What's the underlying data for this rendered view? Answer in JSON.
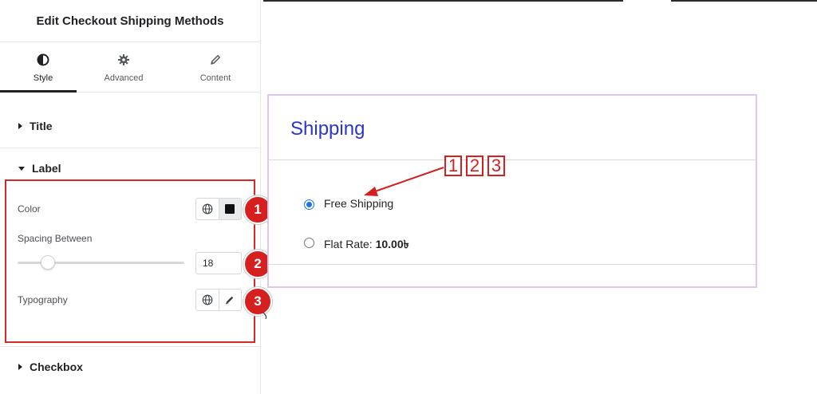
{
  "panel": {
    "title": "Edit Checkout Shipping Methods",
    "tabs": [
      {
        "label": "Style",
        "icon": "contrast-icon",
        "active": true
      },
      {
        "label": "Advanced",
        "icon": "gear-icon",
        "active": false
      },
      {
        "label": "Content",
        "icon": "pencil-icon",
        "active": false
      }
    ],
    "sections": {
      "title": "Title",
      "label": "Label",
      "checkbox": "Checkbox"
    },
    "controls": {
      "color_label": "Color",
      "spacing_label": "Spacing Between",
      "spacing_value": "18",
      "spacing_level": 0.18,
      "typography_label": "Typography"
    },
    "badges": [
      "1",
      "2",
      "3"
    ]
  },
  "preview": {
    "heading": "Shipping",
    "options": [
      {
        "label": "Free Shipping",
        "price": "",
        "checked": true
      },
      {
        "label": "Flat Rate: ",
        "price": "10.00৳",
        "checked": false
      }
    ],
    "callout_numbers": [
      "1",
      "2",
      "3"
    ]
  },
  "colors": {
    "accent_red": "#d61f1f",
    "heading_blue": "#2a35c9",
    "radio_blue": "#1a73e8",
    "preview_border": "#e3c4ee"
  }
}
